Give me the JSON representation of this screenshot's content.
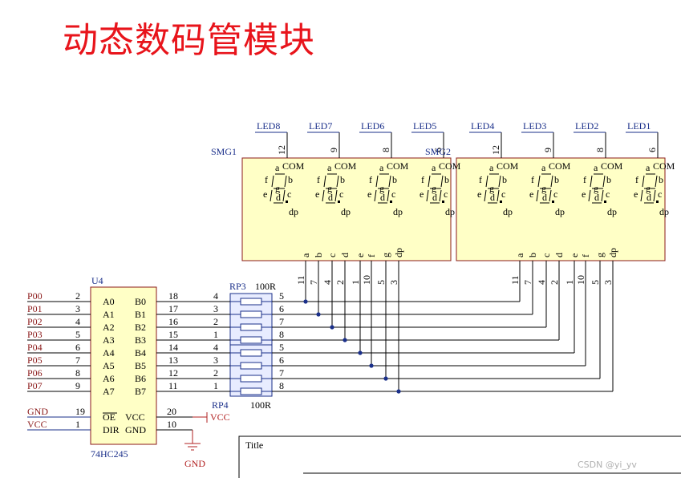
{
  "title": "动态数码管模块",
  "watermark": "CSDN @yi_yv",
  "title_block": {
    "label": "Title"
  },
  "displays": [
    {
      "ref": "SMG1",
      "digits": [
        {
          "net": "LED8",
          "com_pin": "12"
        },
        {
          "net": "LED7",
          "com_pin": "9"
        },
        {
          "net": "LED6",
          "com_pin": "8"
        },
        {
          "net": "LED5",
          "com_pin": "6"
        }
      ]
    },
    {
      "ref": "SMG2",
      "digits": [
        {
          "net": "LED4",
          "com_pin": "12"
        },
        {
          "net": "LED3",
          "com_pin": "9"
        },
        {
          "net": "LED2",
          "com_pin": "8"
        },
        {
          "net": "LED1",
          "com_pin": "6"
        }
      ]
    }
  ],
  "digit_labels": {
    "com": "COM",
    "a": "a",
    "b": "b",
    "c": "c",
    "d": "d",
    "e": "e",
    "f": "f",
    "g": "g",
    "dp": "dp"
  },
  "segment_pins": [
    {
      "seg": "a",
      "pin": "11"
    },
    {
      "seg": "b",
      "pin": "7"
    },
    {
      "seg": "c",
      "pin": "4"
    },
    {
      "seg": "d",
      "pin": "2"
    },
    {
      "seg": "e",
      "pin": "1"
    },
    {
      "seg": "f",
      "pin": "10"
    },
    {
      "seg": "g",
      "pin": "5"
    },
    {
      "seg": "dp",
      "pin": "3"
    }
  ],
  "buffer": {
    "ref": "U4",
    "part": "74HC245",
    "inputs": [
      {
        "net": "P00",
        "pin": "2",
        "name": "A0"
      },
      {
        "net": "P01",
        "pin": "3",
        "name": "A1"
      },
      {
        "net": "P02",
        "pin": "4",
        "name": "A2"
      },
      {
        "net": "P03",
        "pin": "5",
        "name": "A3"
      },
      {
        "net": "P04",
        "pin": "6",
        "name": "A4"
      },
      {
        "net": "P05",
        "pin": "7",
        "name": "A5"
      },
      {
        "net": "P06",
        "pin": "8",
        "name": "A6"
      },
      {
        "net": "P07",
        "pin": "9",
        "name": "A7"
      }
    ],
    "outputs": [
      {
        "name": "B0",
        "pin": "18"
      },
      {
        "name": "B1",
        "pin": "17"
      },
      {
        "name": "B2",
        "pin": "16"
      },
      {
        "name": "B3",
        "pin": "15"
      },
      {
        "name": "B4",
        "pin": "14"
      },
      {
        "name": "B5",
        "pin": "13"
      },
      {
        "name": "B6",
        "pin": "12"
      },
      {
        "name": "B7",
        "pin": "11"
      }
    ],
    "control": [
      {
        "net": "GND",
        "pin": "19",
        "name": "OE"
      },
      {
        "net": "VCC",
        "pin": "1",
        "name": "DIR"
      }
    ],
    "power": [
      {
        "name": "VCC",
        "pin": "20"
      },
      {
        "name": "GND",
        "pin": "10"
      }
    ]
  },
  "resistor_arrays": [
    {
      "ref": "RP3",
      "value": "100R",
      "left_pins": [
        "4",
        "3",
        "2",
        "1"
      ],
      "right_pins": [
        "5",
        "6",
        "7",
        "8"
      ]
    },
    {
      "ref": "RP4",
      "value": "100R",
      "left_pins": [
        "4",
        "3",
        "2",
        "1"
      ],
      "right_pins": [
        "5",
        "6",
        "7",
        "8"
      ]
    }
  ],
  "power_symbols": {
    "vcc": "VCC",
    "gnd": "GND"
  }
}
